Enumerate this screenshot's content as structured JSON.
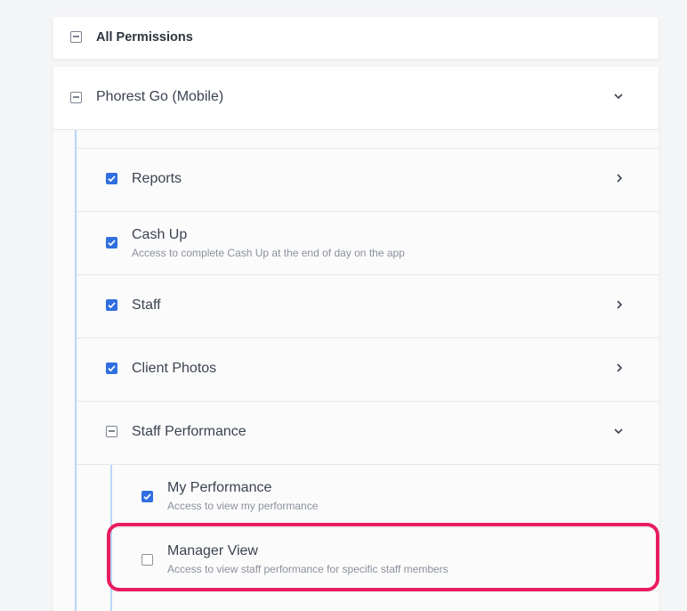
{
  "all_permissions": {
    "label": "All Permissions",
    "state": "partial"
  },
  "group": {
    "label": "Phorest Go (Mobile)",
    "state": "partial",
    "expanded": true
  },
  "items": [
    {
      "label": "Reports",
      "state": "checked",
      "has_children": true
    },
    {
      "label": "Cash Up",
      "description": "Access to complete Cash Up at the end of day on the app",
      "state": "checked"
    },
    {
      "label": "Staff",
      "state": "checked",
      "has_children": true
    },
    {
      "label": "Client Photos",
      "state": "checked",
      "has_children": true
    },
    {
      "label": "Staff Performance",
      "state": "partial",
      "expanded": true
    }
  ],
  "sub_items": [
    {
      "label": "My Performance",
      "description": "Access to view my performance",
      "state": "checked"
    },
    {
      "label": "Manager View",
      "description": "Access to view staff performance for specific staff members",
      "state": "unchecked",
      "highlighted": true
    }
  ],
  "colors": {
    "accent": "#2f6fe0",
    "highlight": "#ea1c60",
    "tree_line": "#b9d6f7"
  }
}
